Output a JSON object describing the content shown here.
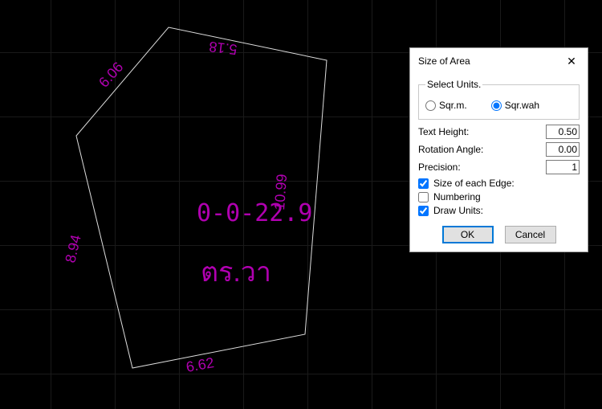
{
  "canvas": {
    "area_text": "0-0-22.9",
    "unit_label": "ตร.วา",
    "edges": {
      "e1": "5.18",
      "e2": "10.99",
      "e3": "6.62",
      "e4": "8.94",
      "e5": "6.06"
    }
  },
  "dialog": {
    "title": "Size of Area",
    "units_legend": "Select Units.",
    "radio_sqm": "Sqr.m.",
    "radio_sqwah": "Sqr.wah",
    "selected_unit": "sqwah",
    "text_height_label": "Text Height:",
    "text_height_value": "0.50",
    "rotation_label": "Rotation Angle:",
    "rotation_value": "0.00",
    "precision_label": "Precision:",
    "precision_value": "1",
    "chk_edge_label": "Size of each Edge:",
    "chk_edge": true,
    "chk_numbering_label": "Numbering",
    "chk_numbering": false,
    "chk_drawunits_label": "Draw Units:",
    "chk_drawunits": true,
    "ok": "OK",
    "cancel": "Cancel"
  }
}
